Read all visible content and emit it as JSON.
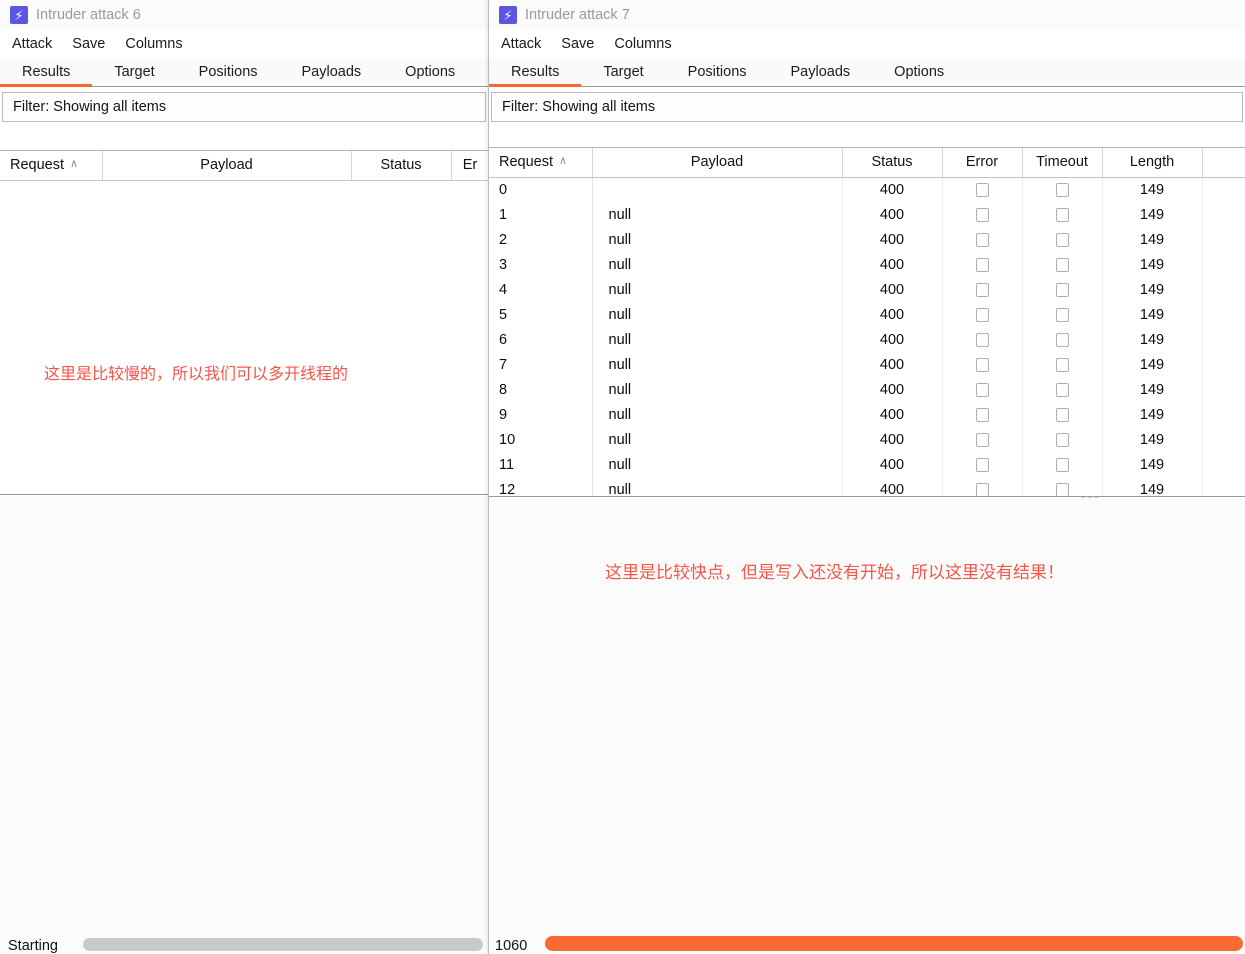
{
  "left_window": {
    "title": "Intruder attack 6",
    "icon": "burp-lightning-icon",
    "menu": [
      "Attack",
      "Save",
      "Columns"
    ],
    "tabs": [
      {
        "label": "Results",
        "active": true
      },
      {
        "label": "Target",
        "active": false
      },
      {
        "label": "Positions",
        "active": false
      },
      {
        "label": "Payloads",
        "active": false
      },
      {
        "label": "Options",
        "active": false
      }
    ],
    "filter": "Filter: Showing all items",
    "columns": [
      "Request",
      "Payload",
      "Status",
      "Er"
    ],
    "sort_caret": "∧",
    "rows": [],
    "annotation": "这里是比较慢的，所以我们可以多开线程的",
    "annotation_color": "#f4564a",
    "status_text": "Starting",
    "progress_color": "#c9c9c9"
  },
  "right_window": {
    "title": "Intruder attack 7",
    "icon": "burp-lightning-icon",
    "menu": [
      "Attack",
      "Save",
      "Columns"
    ],
    "tabs": [
      {
        "label": "Results",
        "active": true
      },
      {
        "label": "Target",
        "active": false
      },
      {
        "label": "Positions",
        "active": false
      },
      {
        "label": "Payloads",
        "active": false
      },
      {
        "label": "Options",
        "active": false
      }
    ],
    "filter": "Filter: Showing all items",
    "columns": [
      "Request",
      "Payload",
      "Status",
      "Error",
      "Timeout",
      "Length"
    ],
    "sort_caret": "∧",
    "rows": [
      {
        "request": "0",
        "payload": "",
        "status": "400",
        "error": false,
        "timeout": false,
        "length": "149"
      },
      {
        "request": "1",
        "payload": "null",
        "status": "400",
        "error": false,
        "timeout": false,
        "length": "149"
      },
      {
        "request": "2",
        "payload": "null",
        "status": "400",
        "error": false,
        "timeout": false,
        "length": "149"
      },
      {
        "request": "3",
        "payload": "null",
        "status": "400",
        "error": false,
        "timeout": false,
        "length": "149"
      },
      {
        "request": "4",
        "payload": "null",
        "status": "400",
        "error": false,
        "timeout": false,
        "length": "149"
      },
      {
        "request": "5",
        "payload": "null",
        "status": "400",
        "error": false,
        "timeout": false,
        "length": "149"
      },
      {
        "request": "6",
        "payload": "null",
        "status": "400",
        "error": false,
        "timeout": false,
        "length": "149"
      },
      {
        "request": "7",
        "payload": "null",
        "status": "400",
        "error": false,
        "timeout": false,
        "length": "149"
      },
      {
        "request": "8",
        "payload": "null",
        "status": "400",
        "error": false,
        "timeout": false,
        "length": "149"
      },
      {
        "request": "9",
        "payload": "null",
        "status": "400",
        "error": false,
        "timeout": false,
        "length": "149"
      },
      {
        "request": "10",
        "payload": "null",
        "status": "400",
        "error": false,
        "timeout": false,
        "length": "149"
      },
      {
        "request": "11",
        "payload": "null",
        "status": "400",
        "error": false,
        "timeout": false,
        "length": "149"
      },
      {
        "request": "12",
        "payload": "null",
        "status": "400",
        "error": false,
        "timeout": false,
        "length": "149"
      }
    ],
    "annotation": "这里是比较快点，但是写入还没有开始，所以这里没有结果！",
    "annotation_color": "#f4564a",
    "status_text": "1060",
    "progress_color": "#fc6a33",
    "resize_grip": "•••"
  },
  "theme": {
    "accent": "#fc6433",
    "icon_bg": "#5a56e0",
    "title_color": "#9a9a9a"
  }
}
